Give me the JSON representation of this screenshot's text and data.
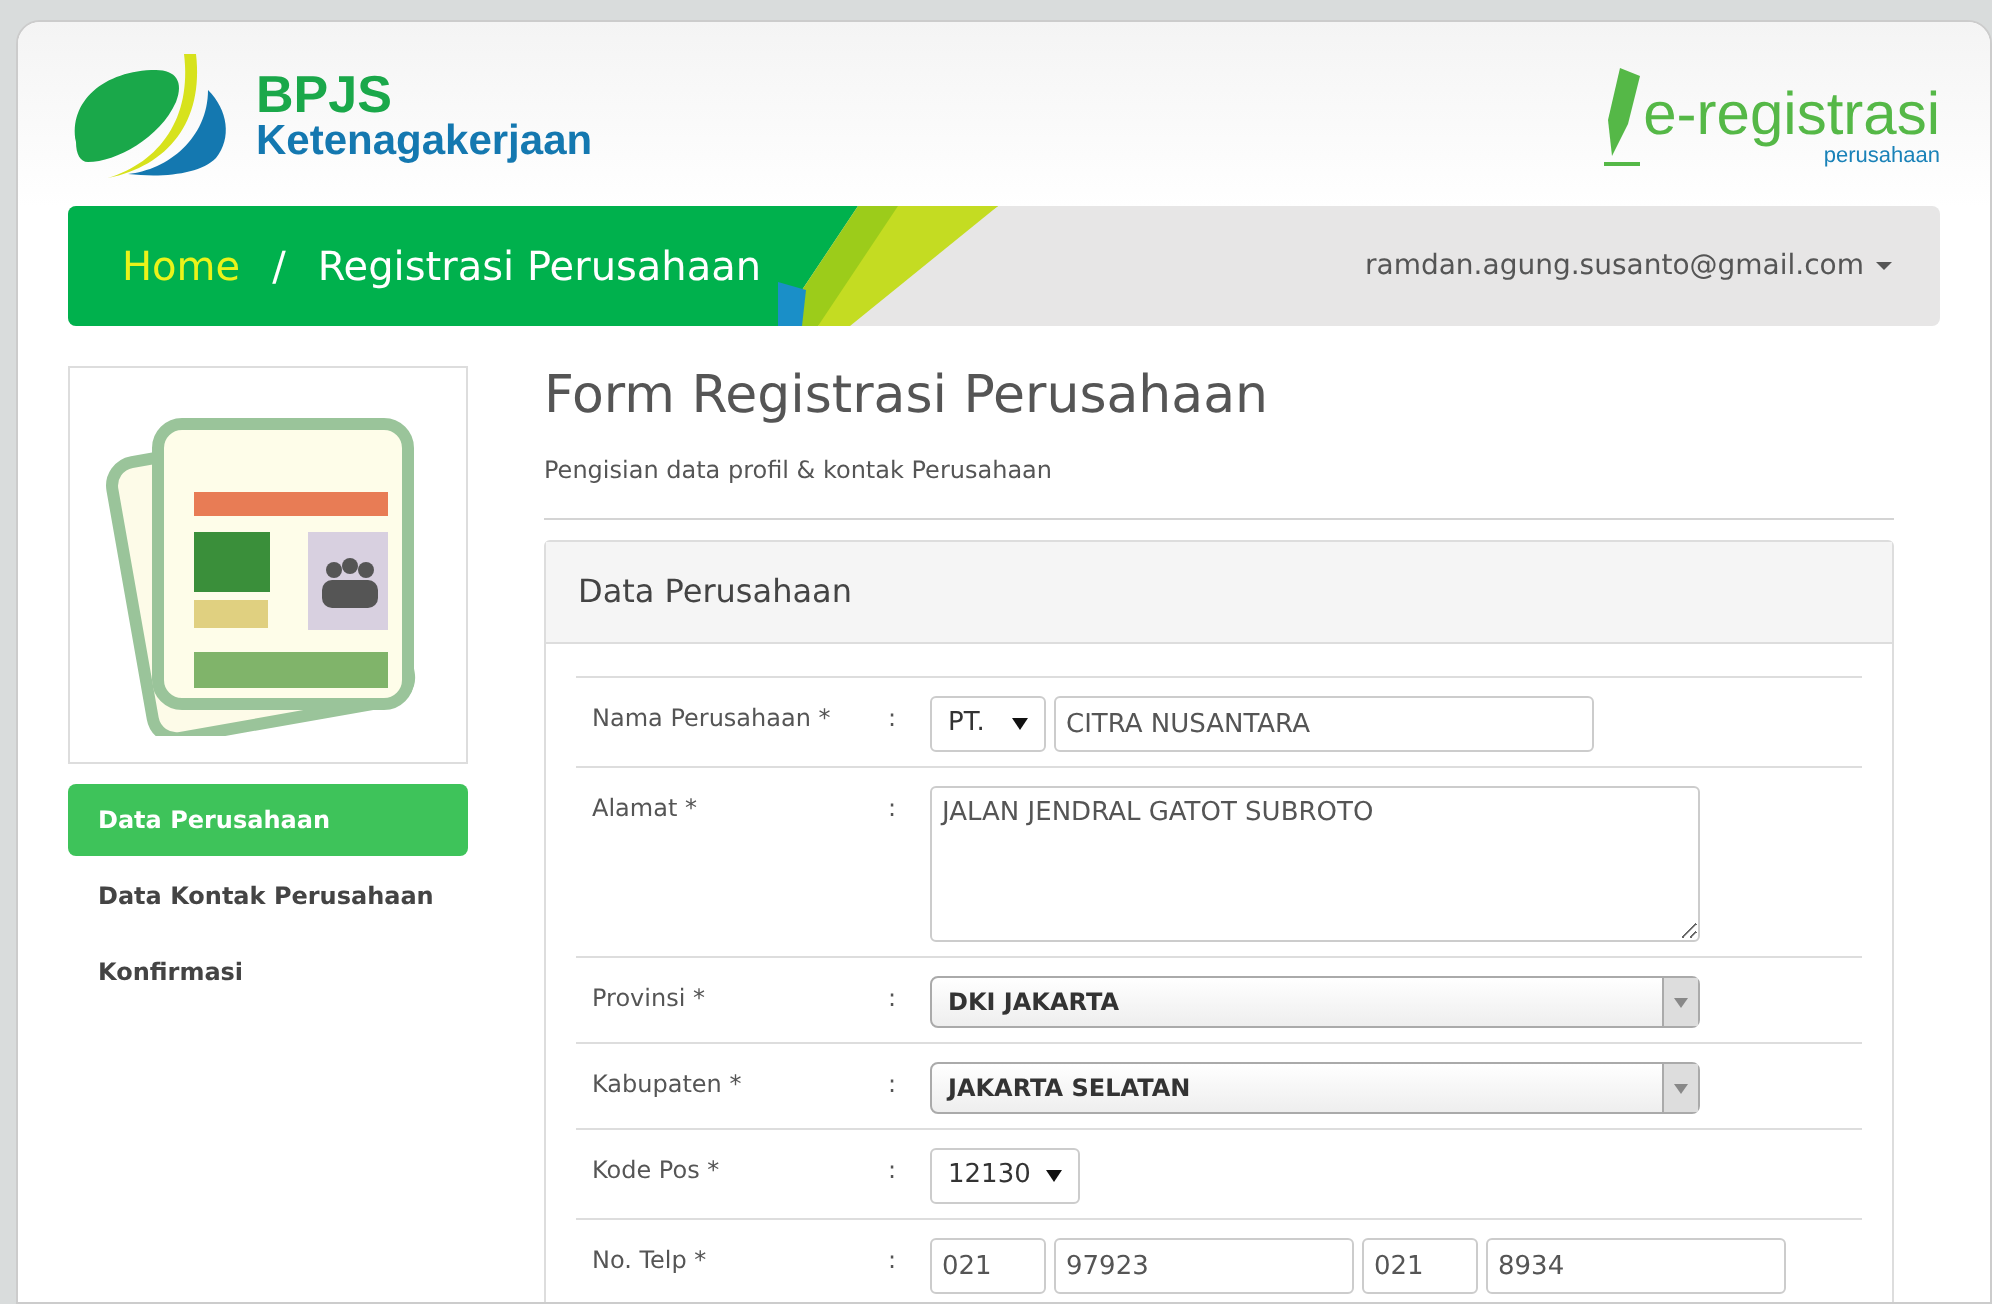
{
  "header": {
    "logo_title": "BPJS",
    "logo_subtitle": "Ketenagakerjaan",
    "app_logo_title": "e-registrasi",
    "app_logo_subtitle": "perusahaan"
  },
  "breadcrumb": {
    "home": "Home",
    "separator": "/",
    "current": "Registrasi Perusahaan"
  },
  "user_menu": {
    "email": "ramdan.agung.susanto@gmail.com"
  },
  "sidebar": {
    "items": [
      {
        "label": "Data Perusahaan",
        "selected": true
      },
      {
        "label": "Data Kontak Perusahaan",
        "selected": false
      },
      {
        "label": "Konfirmasi",
        "selected": false
      }
    ]
  },
  "page": {
    "title": "Form Registrasi Perusahaan",
    "subtitle": "Pengisian data profil & kontak Perusahaan"
  },
  "panel": {
    "title": "Data Perusahaan",
    "rows": [
      {
        "label": "Nama Perusahaan *",
        "colon": ":",
        "fields": [
          {
            "kind": "select",
            "value": "PT."
          },
          {
            "kind": "text",
            "value": "CITRA NUSANTARA"
          }
        ]
      },
      {
        "label": "Alamat *",
        "colon": ":",
        "fields": [
          {
            "kind": "textarea",
            "value": "JALAN JENDRAL GATOT SUBROTO"
          }
        ]
      },
      {
        "label": "Provinsi *",
        "colon": ":",
        "fields": [
          {
            "kind": "combo",
            "value": "DKI JAKARTA"
          }
        ]
      },
      {
        "label": "Kabupaten *",
        "colon": ":",
        "fields": [
          {
            "kind": "combo",
            "value": "JAKARTA SELATAN"
          }
        ]
      },
      {
        "label": "Kode Pos *",
        "colon": ":",
        "fields": [
          {
            "kind": "select",
            "value": "12130"
          }
        ]
      },
      {
        "label": "No. Telp *",
        "colon": ":",
        "fields": [
          {
            "kind": "text",
            "value": "021"
          },
          {
            "kind": "text",
            "value": "97923"
          },
          {
            "kind": "text",
            "value": "021"
          },
          {
            "kind": "text",
            "value": "8934"
          }
        ]
      }
    ]
  }
}
